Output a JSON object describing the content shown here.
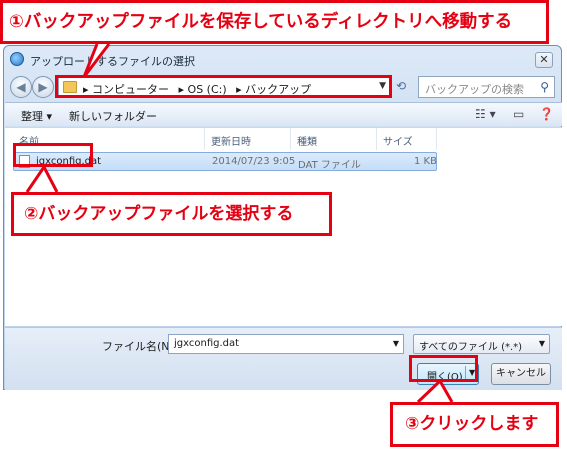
{
  "dialog": {
    "title": "アップロードするファイルの選択",
    "close_label": "✕"
  },
  "nav": {
    "back_icon": "◀",
    "forward_icon": "▶",
    "breadcrumbs": [
      "▸ コンピューター",
      "▸ OS (C:)",
      "▸ バックアップ"
    ],
    "refresh_icon": "⟲",
    "search_placeholder": "バックアップの検索"
  },
  "toolbar": {
    "organize_label": "整理 ▾",
    "new_folder_label": "新しいフォルダー"
  },
  "columns": {
    "name": "名前",
    "modified": "更新日時",
    "type": "種類",
    "size": "サイズ"
  },
  "files": [
    {
      "name": "jgxconfig.dat",
      "modified": "2014/07/23 9:05",
      "type": "DAT ファイル",
      "size": "1 KB",
      "selected": true
    }
  ],
  "bottom": {
    "filename_label": "ファイル名(N):",
    "filename_value": "jgxconfig.dat",
    "filetype_value": "すべてのファイル (*.*)",
    "open_label": "開く(O)",
    "cancel_label": "キャンセル"
  },
  "annotations": {
    "step1": "①バックアップファイルを保存しているディレクトリへ移動する",
    "step2": "②バックアップファイルを選択する",
    "step3": "③クリックします"
  },
  "colors": {
    "accent_red": "#e50012",
    "selection": "#c4ddf8"
  }
}
